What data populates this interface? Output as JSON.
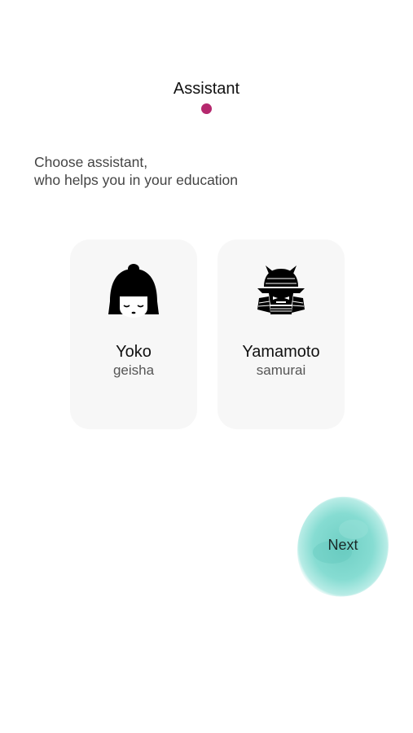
{
  "header": {
    "title": "Assistant"
  },
  "intro": {
    "line1": "Choose assistant,",
    "line2": "who helps you in your education"
  },
  "assistants": [
    {
      "name": "Yoko",
      "role": "geisha",
      "icon": "geisha-icon"
    },
    {
      "name": "Yamamoto",
      "role": "samurai",
      "icon": "samurai-helmet-icon"
    }
  ],
  "next_button": {
    "label": "Next",
    "color": "#7fd6cc"
  },
  "colors": {
    "step_dot": "#b5286e",
    "card_background": "#f7f7f7"
  }
}
